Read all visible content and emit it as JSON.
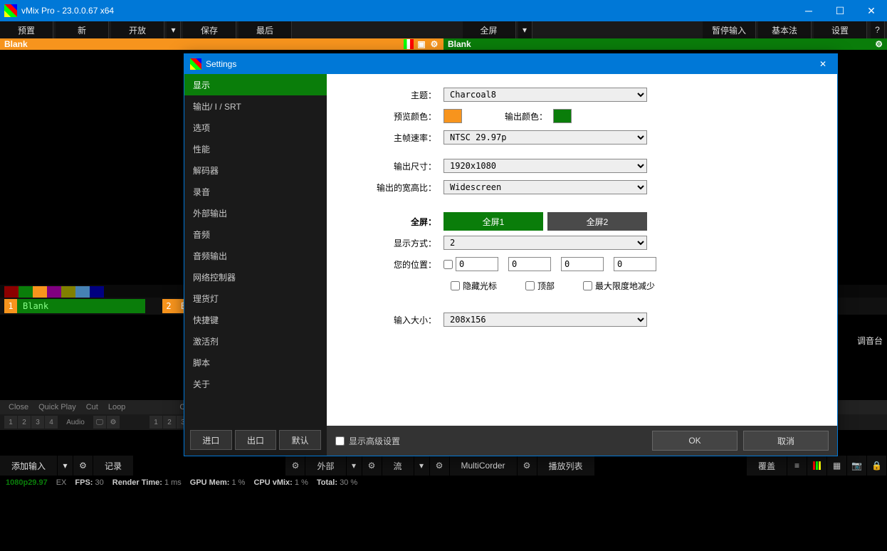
{
  "title": "vMix Pro - 23.0.0.67 x64",
  "toolbar": {
    "preset": "预置",
    "new": "新",
    "open": "开放",
    "save": "保存",
    "last": "最后",
    "fullscreen": "全屏",
    "pause": "暂停输入",
    "basic": "基本法",
    "settings": "设置",
    "help": "?"
  },
  "preview": {
    "left": "Blank",
    "right": "Blank"
  },
  "inputs": {
    "one": {
      "num": "1",
      "label": "Blank"
    },
    "two": {
      "num": "2",
      "label": "Bl"
    }
  },
  "ctrl": {
    "close": "Close",
    "quickplay": "Quick Play",
    "cut": "Cut",
    "loop": "Loop",
    "audio": "Audio"
  },
  "audiomixer": "调音台",
  "bottom": {
    "addinput": "添加输入",
    "record": "记录",
    "external": "外部",
    "stream": "流",
    "multicorder": "MultiCorder",
    "playlist": "播放列表",
    "overlay": "覆盖"
  },
  "status": {
    "res": "1080p29.97",
    "ex": "EX",
    "fps_l": "FPS:",
    "fps": "30",
    "rt_l": "Render Time:",
    "rt": "1 ms",
    "gpu_l": "GPU Mem:",
    "gpu": "1 %",
    "cpu_l": "CPU vMix:",
    "cpu": "1 %",
    "tot_l": "Total:",
    "tot": "30 %"
  },
  "modal": {
    "title": "Settings",
    "sidebar": [
      "显示",
      "输出/ I / SRT",
      "选项",
      "性能",
      "解码器",
      "录音",
      "外部输出",
      "音频",
      "音频输出",
      "网络控制器",
      "理货灯",
      "快捷键",
      "激活剂",
      "脚本",
      "关于"
    ],
    "sbtns": {
      "import": "进口",
      "export": "出口",
      "default": "默认"
    },
    "labels": {
      "theme": "主题：",
      "prevcolor": "预览颜色：",
      "outcolor": "输出颜色：",
      "framerate": "主帧速率：",
      "outsize": "输出尺寸：",
      "aspect": "输出的宽高比：",
      "fullscreen": "全屏：",
      "fs1": "全屏1",
      "fs2": "全屏2",
      "display": "显示方式：",
      "position": "您的位置：",
      "hidecursor": "隐藏光标",
      "top": "顶部",
      "minimize": "最大限度地减少",
      "inputsize": "输入大小："
    },
    "values": {
      "theme": "Charcoal8",
      "framerate": "NTSC 29.97p",
      "outsize": "1920x1080",
      "aspect": "Widescreen",
      "display": "2",
      "p0": "0",
      "p1": "0",
      "p2": "0",
      "p3": "0",
      "inputsize": "208x156"
    },
    "footer": {
      "adv": "显示高级设置",
      "ok": "OK",
      "cancel": "取消"
    }
  }
}
